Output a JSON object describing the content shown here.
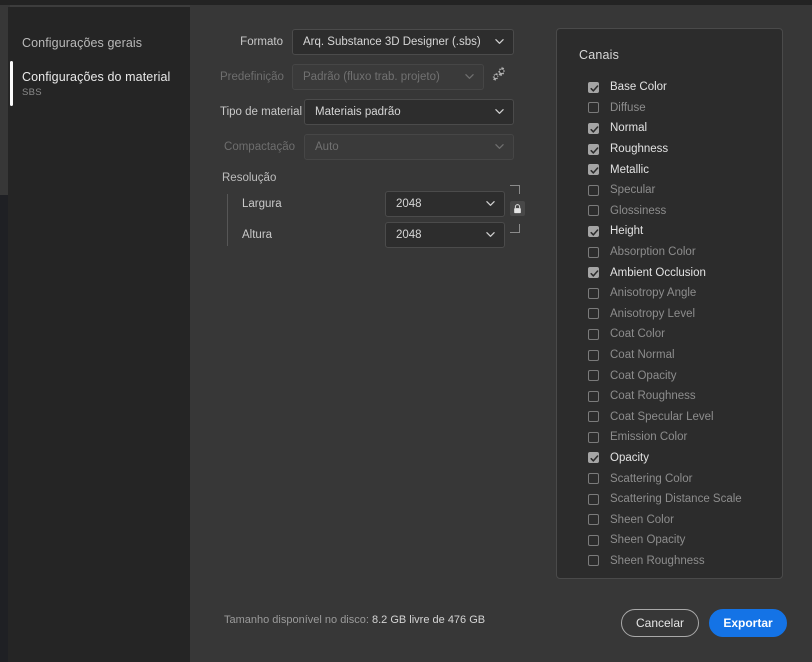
{
  "sidebar": {
    "items": [
      {
        "label": "Configurações gerais",
        "sub": null,
        "active": false
      },
      {
        "label": "Configurações do material",
        "sub": "SBS",
        "active": true
      }
    ]
  },
  "form": {
    "formato": {
      "label": "Formato",
      "value": "Arq. Substance 3D Designer (.sbs)",
      "disabled": false
    },
    "predefinicao": {
      "label": "Predefinição",
      "value": "Padrão (fluxo trab. projeto)",
      "disabled": true
    },
    "tipo_material": {
      "label": "Tipo de material",
      "value": "Materiais padrão",
      "disabled": false
    },
    "compactacao": {
      "label": "Compactação",
      "value": "Auto",
      "disabled": true
    },
    "resolucao": {
      "title": "Resolução",
      "largura": {
        "label": "Largura",
        "value": "2048"
      },
      "altura": {
        "label": "Altura",
        "value": "2048"
      },
      "lock_icon": "lock-icon"
    },
    "gear_icon": "gears-icon"
  },
  "channels": {
    "title": "Canais",
    "items": [
      {
        "label": "Base Color",
        "checked": true
      },
      {
        "label": "Diffuse",
        "checked": false
      },
      {
        "label": "Normal",
        "checked": true
      },
      {
        "label": "Roughness",
        "checked": true
      },
      {
        "label": "Metallic",
        "checked": true
      },
      {
        "label": "Specular",
        "checked": false
      },
      {
        "label": "Glossiness",
        "checked": false
      },
      {
        "label": "Height",
        "checked": true
      },
      {
        "label": "Absorption Color",
        "checked": false
      },
      {
        "label": "Ambient Occlusion",
        "checked": true
      },
      {
        "label": "Anisotropy Angle",
        "checked": false
      },
      {
        "label": "Anisotropy Level",
        "checked": false
      },
      {
        "label": "Coat Color",
        "checked": false
      },
      {
        "label": "Coat Normal",
        "checked": false
      },
      {
        "label": "Coat Opacity",
        "checked": false
      },
      {
        "label": "Coat Roughness",
        "checked": false
      },
      {
        "label": "Coat Specular Level",
        "checked": false
      },
      {
        "label": "Emission Color",
        "checked": false
      },
      {
        "label": "Opacity",
        "checked": true
      },
      {
        "label": "Scattering Color",
        "checked": false
      },
      {
        "label": "Scattering Distance Scale",
        "checked": false
      },
      {
        "label": "Sheen Color",
        "checked": false
      },
      {
        "label": "Sheen Opacity",
        "checked": false
      },
      {
        "label": "Sheen Roughness",
        "checked": false
      }
    ]
  },
  "footer": {
    "disk_label": "Tamanho disponível no disco:",
    "disk_value": "8.2 GB livre de 476 GB",
    "cancel_label": "Cancelar",
    "export_label": "Exportar"
  },
  "colors": {
    "accent": "#1473e6",
    "panel_bg": "#2c2c2c",
    "main_bg": "#373737",
    "sidebar_bg": "#252525"
  }
}
